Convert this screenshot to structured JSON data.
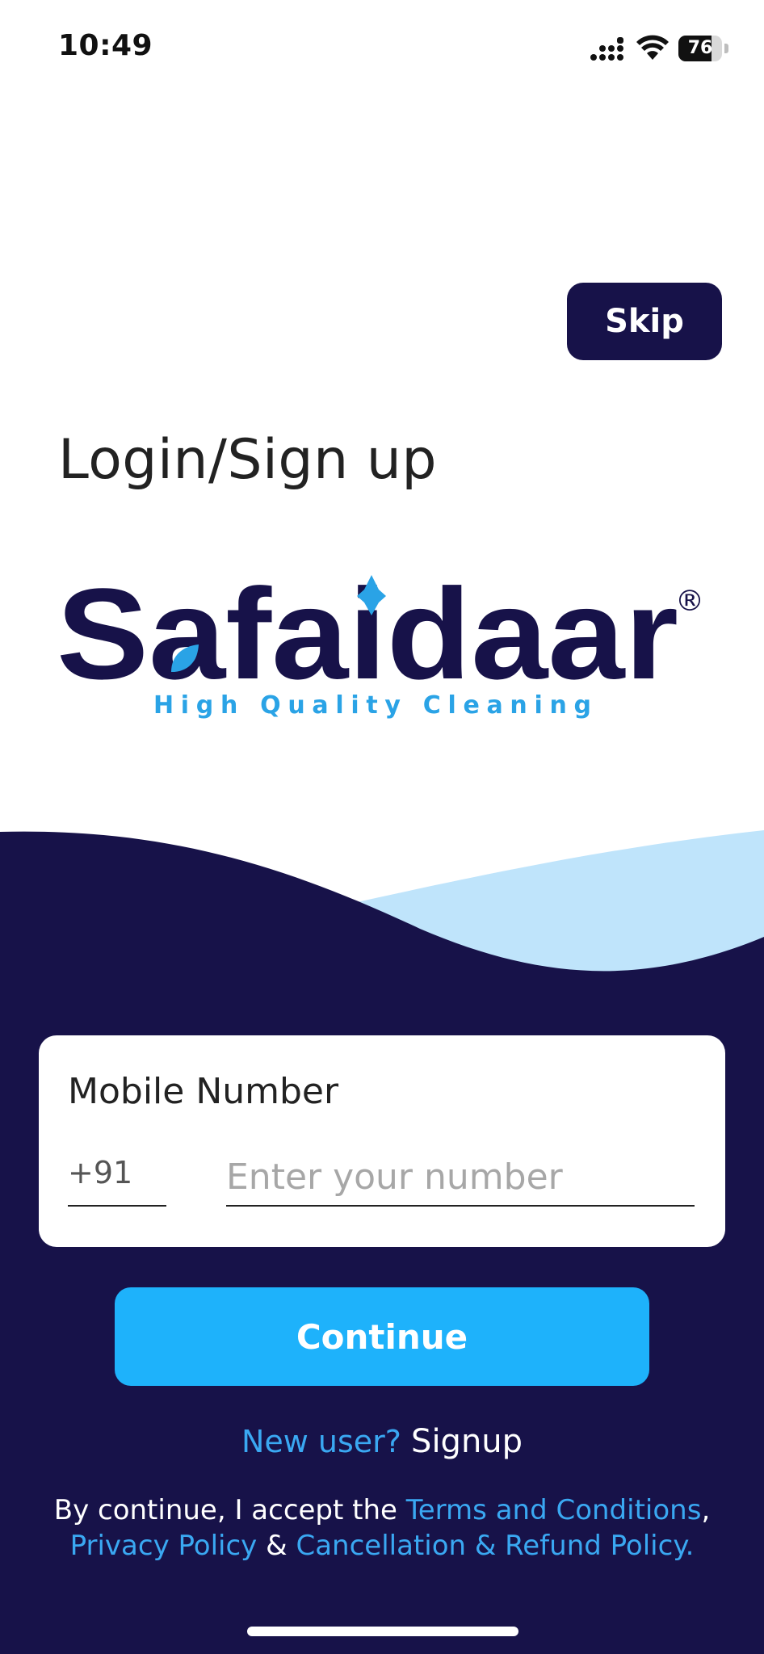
{
  "status_bar": {
    "time": "10:49",
    "battery_level": "76",
    "battery_fraction": 0.76,
    "icons": [
      "signal-icon",
      "wifi-icon",
      "battery-icon"
    ]
  },
  "header": {
    "skip_label": "Skip",
    "title": "Login/Sign up"
  },
  "brand": {
    "name": "Safaidaar",
    "tagline": "High Quality Cleaning",
    "registered_mark": "®"
  },
  "login_form": {
    "field_label": "Mobile Number",
    "country_code": "+91",
    "number_value": "",
    "number_placeholder": "Enter your number",
    "continue_label": "Continue"
  },
  "signup": {
    "prompt": "New user?",
    "link": "Signup"
  },
  "terms": {
    "prefix": "By continue, I accept the ",
    "terms_link": "Terms and Conditions",
    "comma": ",",
    "privacy_link": "Privacy Policy",
    "ampersand": " & ",
    "refund_link": "Cancellation & Refund Policy."
  },
  "colors": {
    "navy": "#171249",
    "accent_blue": "#1eb2fb",
    "link_blue": "#3aa8f2",
    "light_wave": "#bfe4fb"
  }
}
